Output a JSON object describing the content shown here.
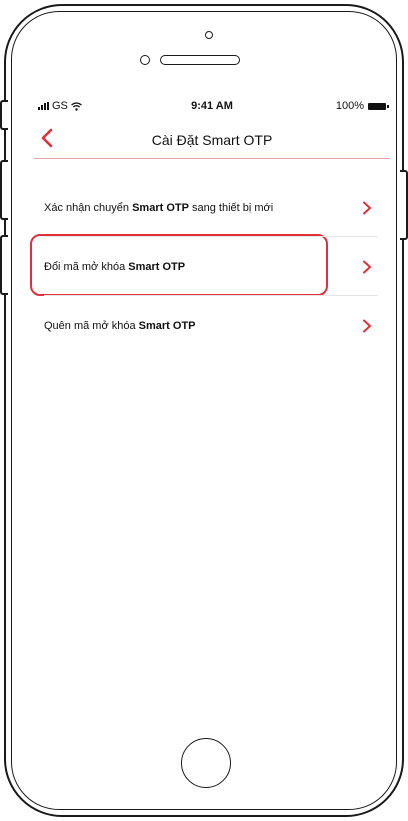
{
  "status_bar": {
    "carrier": "GS",
    "time": "9:41 AM",
    "battery": "100%"
  },
  "nav": {
    "title": "Cài Đặt Smart OTP",
    "back_icon": "chevron-left-icon"
  },
  "menu": {
    "items": [
      {
        "prefix": "Xác nhận chuyển ",
        "bold": "Smart OTP",
        "suffix": " sang thiết bị mới"
      },
      {
        "prefix": "Đổi mã mở khóa ",
        "bold": "Smart OTP",
        "suffix": ""
      },
      {
        "prefix": "Quên mã mở khóa ",
        "bold": "Smart OTP",
        "suffix": ""
      }
    ]
  },
  "colors": {
    "accent": "#e0303a",
    "divider": "#e5e5e5"
  }
}
